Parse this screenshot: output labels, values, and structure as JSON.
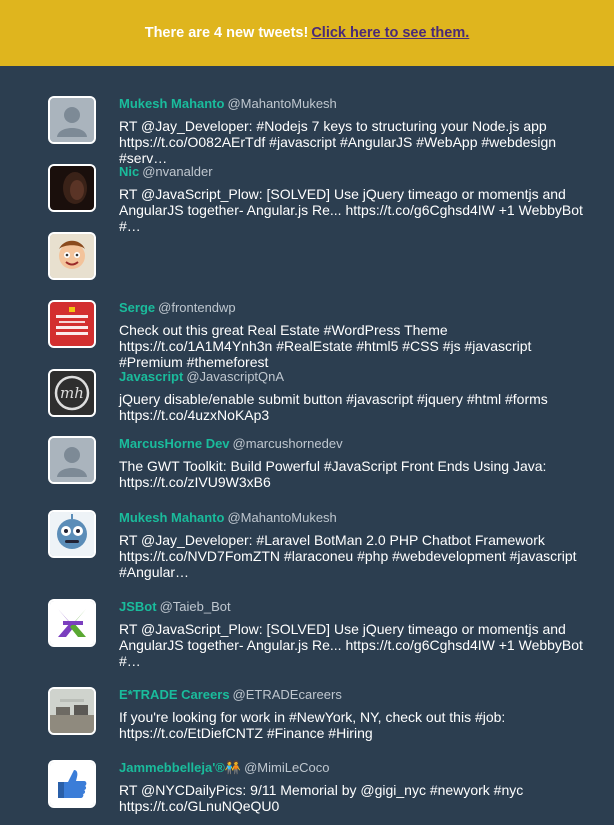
{
  "banner": {
    "message": "There are 4 new tweets!",
    "link": "Click here to see them."
  },
  "colors": {
    "background": "#2c3e50",
    "banner": "#dfb51e",
    "banner_link": "#4a2a78",
    "name": "#1abc9c",
    "handle": "#bfc7cf"
  },
  "tweets": [
    {
      "name": "Mukesh Mahanto",
      "handle": "@MahantoMukesh",
      "avatar": "default-avatar-icon",
      "lines": [
        "RT @Jay_Developer: #Nodejs 7 keys to structuring your Node.js app",
        "https://t.co/O082AErTdf #javascript #AngularJS #WebApp #webdesign",
        "#serv…"
      ]
    },
    {
      "name": "Nic",
      "handle": "@nvanalder",
      "avatar": "dark-photo-avatar",
      "lines": [
        "RT @JavaScript_Plow: [SOLVED] Use jQuery timeago or momentjs and",
        "AngularJS together- Angular.js Re... https://t.co/g6Cghsd4IW +1 WebbyBot",
        "#…"
      ]
    },
    {
      "name": "Serge",
      "handle": "@frontendwp",
      "avatar": "keep-calm-javascript-avatar",
      "lines": [
        "Check out this great Real Estate #WordPress Theme",
        "https://t.co/1A1M4Ynh3n #RealEstate #html5 #CSS #js #javascript",
        "#Premium #themeforest"
      ]
    },
    {
      "name": "Javascript",
      "handle": "@JavascriptQnA",
      "avatar": "mh-logo-avatar",
      "lines": [
        "jQuery disable/enable submit button #javascript #jquery #html #forms",
        "https://t.co/4uzxNoKAp3"
      ]
    },
    {
      "name": "MarcusHorne Dev",
      "handle": "@marcushornedev",
      "avatar": "default-avatar-icon",
      "lines": [
        "The GWT Toolkit: Build Powerful #JavaScript Front Ends Using Java:",
        "https://t.co/zIVU9W3xB6"
      ]
    },
    {
      "name": "Mukesh Mahanto",
      "handle": "@MahantoMukesh",
      "avatar": "robot-avatar",
      "lines": [
        "RT @Jay_Developer: #Laravel BotMan 2.0 PHP Chatbot Framework",
        "https://t.co/NVD7FomZTN #laraconeu #php #webdevelopment #javascript",
        "#Angular…"
      ]
    },
    {
      "name": "JSBot",
      "handle": "@Taieb_Bot",
      "avatar": "colored-x-logo-avatar",
      "lines": [
        "RT @JavaScript_Plow: [SOLVED] Use jQuery timeago or momentjs and",
        "AngularJS together- Angular.js Re... https://t.co/g6Cghsd4IW +1 WebbyBot",
        "#…"
      ]
    },
    {
      "name": "E*TRADE Careers",
      "handle": "@ETRADEcareers",
      "avatar": "office-photo-avatar",
      "lines": [
        "If you're looking for work in #NewYork, NY, check out this #job:",
        "https://t.co/EtDiefCNTZ #Finance #Hiring"
      ]
    },
    {
      "name": "Jammebbelleja'®🧑‍🤝‍🧑",
      "handle": "@MimiLeCoco",
      "avatar": "thumbs-up-avatar",
      "lines": [
        "RT @NYCDailyPics: 9/11 Memorial by @gigi_nyc #newyork #nyc",
        "https://t.co/GLnuNQeQU0"
      ]
    }
  ]
}
